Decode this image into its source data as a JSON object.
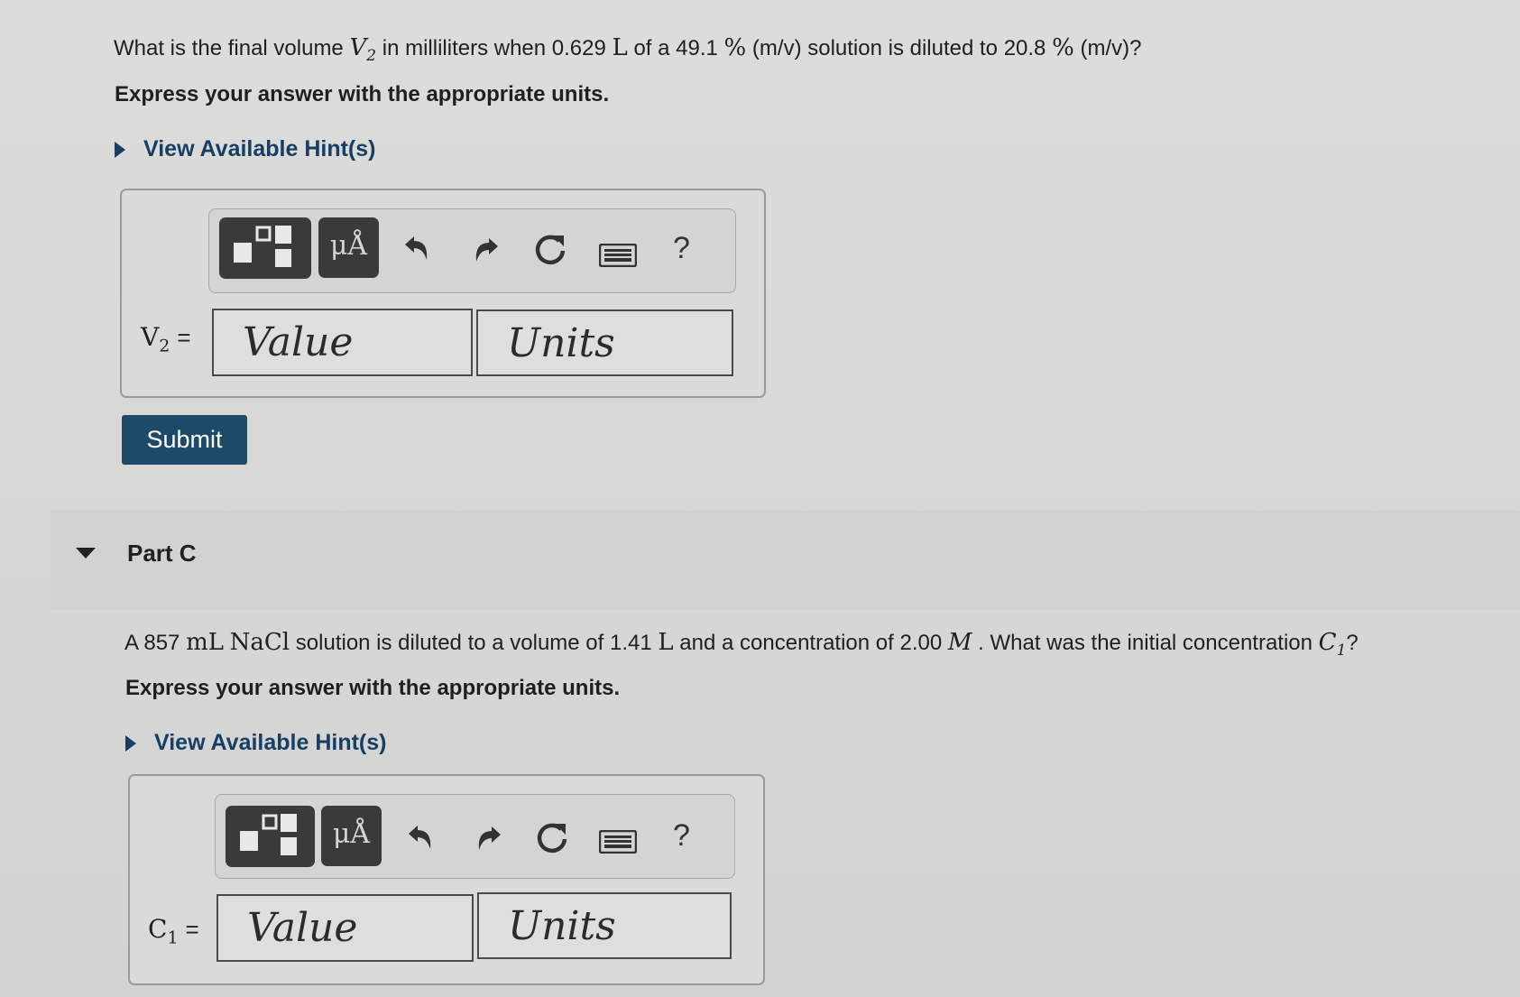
{
  "partB": {
    "question_pre": "What is the final volume ",
    "var_V": "V",
    "var_V_sub": "2",
    "q_mid1": " in milliliters when 0.629 ",
    "unit_L": "L",
    "q_mid2": " of a 49.1 ",
    "pct1": "%",
    "q_mid3": " (m/v) solution is diluted to 20.8 ",
    "pct2": "%",
    "q_end": " (m/v)?",
    "instruction": "Express your answer with the appropriate units.",
    "hint_link": "View Available Hint(s)",
    "answer_label": "V",
    "answer_label_sub": "2",
    "answer_eq": "=",
    "value_placeholder": "Value",
    "units_placeholder": "Units",
    "submit_label": "Submit"
  },
  "toolbar": {
    "mu_button": "μÅ",
    "help": "?"
  },
  "partC": {
    "title": "Part C",
    "q_pre": "A 857 ",
    "unit_mL": "mL",
    "nacl": "NaCl",
    "q_mid1": " solution is diluted to a volume of 1.41 ",
    "unit_L": "L",
    "q_mid2": " and a concentration of 2.00 ",
    "unit_M": "M",
    "q_mid3": " . What was the initial concentration ",
    "var_C": "C",
    "var_C_sub": "1",
    "q_end": "?",
    "instruction": "Express your answer with the appropriate units.",
    "hint_link": "View Available Hint(s)",
    "answer_label": "C",
    "answer_label_sub": "1",
    "answer_eq": "=",
    "value_placeholder": "Value",
    "units_placeholder": "Units"
  },
  "colors": {
    "background": "#d8d8d6",
    "hint_link": "#163f63",
    "submit_button": "#1d4a68",
    "toolbar_dark": "#3a3a3a"
  },
  "icons": [
    "templates-icon",
    "units-icon",
    "undo-icon",
    "redo-icon",
    "reset-icon",
    "keyboard-icon",
    "help-icon"
  ]
}
